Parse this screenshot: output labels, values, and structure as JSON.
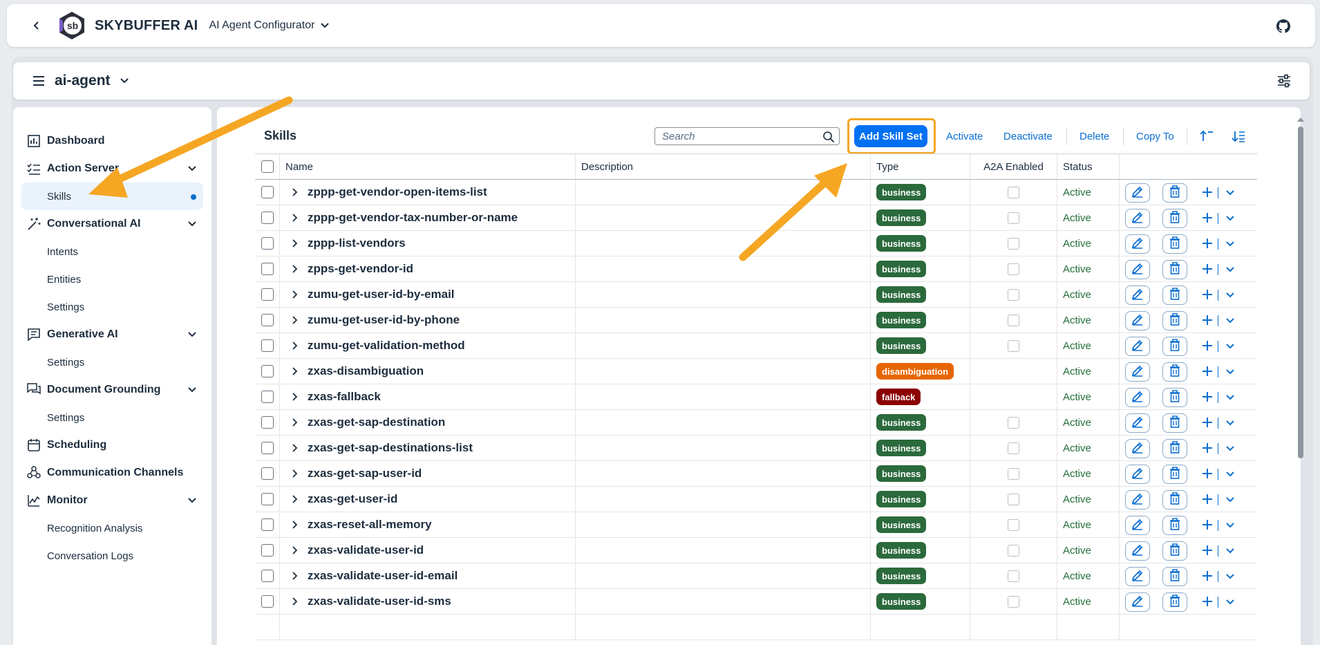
{
  "shell": {
    "brand": "SKYBUFFER AI",
    "app_title": "AI Agent Configurator"
  },
  "header": {
    "agent": "ai-agent"
  },
  "sidebar": {
    "items": [
      {
        "label": "Dashboard",
        "icon": "dashboard-icon",
        "expandable": false
      },
      {
        "label": "Action Server",
        "icon": "checklist-icon",
        "expandable": true
      },
      {
        "label": "Skills",
        "sub": true,
        "selected": true
      },
      {
        "label": "Conversational AI",
        "icon": "magic-wand-icon",
        "expandable": true
      },
      {
        "label": "Intents",
        "sub": true
      },
      {
        "label": "Entities",
        "sub": true
      },
      {
        "label": "Settings",
        "sub": true
      },
      {
        "label": "Generative AI",
        "icon": "chat-icon",
        "expandable": true
      },
      {
        "label": "Settings",
        "sub": true
      },
      {
        "label": "Document Grounding",
        "icon": "discussion-icon",
        "expandable": true
      },
      {
        "label": "Settings",
        "sub": true
      },
      {
        "label": "Scheduling",
        "icon": "calendar-icon",
        "expandable": false
      },
      {
        "label": "Communication Channels",
        "icon": "channels-icon",
        "expandable": false
      },
      {
        "label": "Monitor",
        "icon": "monitor-icon",
        "expandable": true
      },
      {
        "label": "Recognition Analysis",
        "sub": true
      },
      {
        "label": "Conversation Logs",
        "sub": true
      }
    ]
  },
  "toolbar": {
    "title": "Skills",
    "search_placeholder": "Search",
    "add_label": "Add Skill Set",
    "activate_label": "Activate",
    "deactivate_label": "Deactivate",
    "delete_label": "Delete",
    "copy_label": "Copy To"
  },
  "table": {
    "columns": [
      "Name",
      "Description",
      "Type",
      "A2A Enabled",
      "Status"
    ],
    "rows": [
      {
        "name": "zppp-get-vendor-open-items-list",
        "type": "business",
        "a2a": true,
        "status": "Active"
      },
      {
        "name": "zppp-get-vendor-tax-number-or-name",
        "type": "business",
        "a2a": true,
        "status": "Active"
      },
      {
        "name": "zppp-list-vendors",
        "type": "business",
        "a2a": true,
        "status": "Active"
      },
      {
        "name": "zpps-get-vendor-id",
        "type": "business",
        "a2a": true,
        "status": "Active"
      },
      {
        "name": "zumu-get-user-id-by-email",
        "type": "business",
        "a2a": true,
        "status": "Active"
      },
      {
        "name": "zumu-get-user-id-by-phone",
        "type": "business",
        "a2a": true,
        "status": "Active"
      },
      {
        "name": "zumu-get-validation-method",
        "type": "business",
        "a2a": true,
        "status": "Active"
      },
      {
        "name": "zxas-disambiguation",
        "type": "disambiguation",
        "a2a": false,
        "status": "Active"
      },
      {
        "name": "zxas-fallback",
        "type": "fallback",
        "a2a": false,
        "status": "Active"
      },
      {
        "name": "zxas-get-sap-destination",
        "type": "business",
        "a2a": true,
        "status": "Active"
      },
      {
        "name": "zxas-get-sap-destinations-list",
        "type": "business",
        "a2a": true,
        "status": "Active"
      },
      {
        "name": "zxas-get-sap-user-id",
        "type": "business",
        "a2a": true,
        "status": "Active"
      },
      {
        "name": "zxas-get-user-id",
        "type": "business",
        "a2a": true,
        "status": "Active"
      },
      {
        "name": "zxas-reset-all-memory",
        "type": "business",
        "a2a": true,
        "status": "Active"
      },
      {
        "name": "zxas-validate-user-id",
        "type": "business",
        "a2a": true,
        "status": "Active"
      },
      {
        "name": "zxas-validate-user-id-email",
        "type": "business",
        "a2a": true,
        "status": "Active"
      },
      {
        "name": "zxas-validate-user-id-sms",
        "type": "business",
        "a2a": true,
        "status": "Active"
      }
    ]
  },
  "colors": {
    "business": "#2b6a3c",
    "disambiguation": "#e76500",
    "fallback": "#8b0000",
    "accent": "#0070f2",
    "annotation": "#f5a623"
  }
}
